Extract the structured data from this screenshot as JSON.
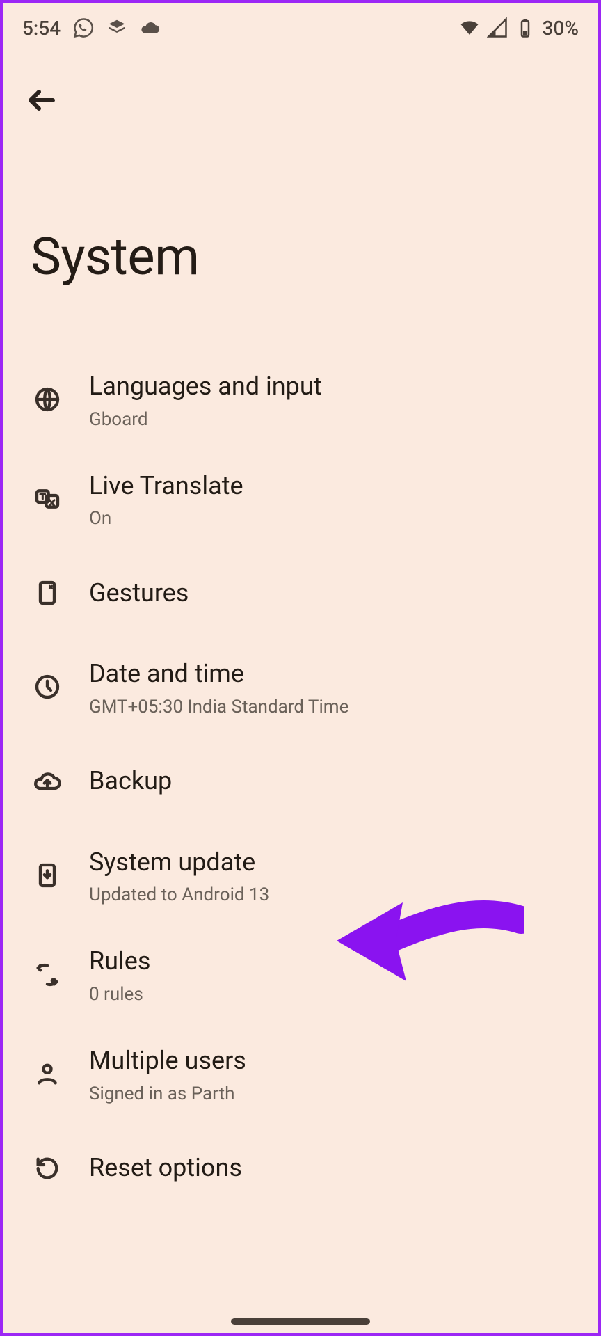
{
  "status": {
    "time": "5:54",
    "battery_pct": "30%"
  },
  "header": {
    "title": "System"
  },
  "items": [
    {
      "title": "Languages and input",
      "sub": "Gboard"
    },
    {
      "title": "Live Translate",
      "sub": "On"
    },
    {
      "title": "Gestures",
      "sub": ""
    },
    {
      "title": "Date and time",
      "sub": "GMT+05:30 India Standard Time"
    },
    {
      "title": "Backup",
      "sub": ""
    },
    {
      "title": "System update",
      "sub": "Updated to Android 13"
    },
    {
      "title": "Rules",
      "sub": "0 rules"
    },
    {
      "title": "Multiple users",
      "sub": "Signed in as Parth"
    },
    {
      "title": "Reset options",
      "sub": ""
    }
  ],
  "annotation": {
    "arrow_color": "#8a13f0"
  }
}
